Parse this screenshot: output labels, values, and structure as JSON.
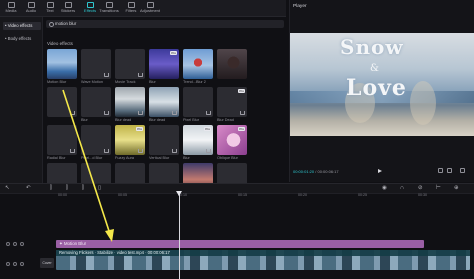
{
  "toolbar": {
    "tabs": [
      {
        "label": "Media",
        "icon": "media-icon"
      },
      {
        "label": "Audio",
        "icon": "audio-icon"
      },
      {
        "label": "Text",
        "icon": "text-icon"
      },
      {
        "label": "Stickers",
        "icon": "stickers-icon"
      },
      {
        "label": "Effects",
        "icon": "effects-icon",
        "active": true
      },
      {
        "label": "Transitions",
        "icon": "transitions-icon"
      },
      {
        "label": "Filters",
        "icon": "filters-icon"
      },
      {
        "label": "Adjustment",
        "icon": "adjustment-icon"
      }
    ],
    "accent_color": "#2fc7cf"
  },
  "left_panel": {
    "categories": [
      {
        "label": "• Video effects",
        "active": true
      },
      {
        "label": "• Body effects",
        "active": false
      }
    ]
  },
  "search": {
    "value": "motion blur"
  },
  "section": {
    "label": "Video effects"
  },
  "effects": [
    {
      "name": "Motion Blur",
      "style": "thumb-photo",
      "pro": false,
      "download": false
    },
    {
      "name": "Wave Motion",
      "style": "thumb-gray",
      "pro": false,
      "download": true
    },
    {
      "name": "Movie Track",
      "style": "thumb-gray",
      "pro": false,
      "download": true
    },
    {
      "name": "Blur",
      "style": "thumb-purple",
      "pro": true,
      "download": false
    },
    {
      "name": "Trend...Blur 2",
      "style": "thumb-photo2",
      "pro": false,
      "download": false
    },
    {
      "name": "",
      "style": "thumb-dark",
      "pro": false,
      "download": false
    },
    {
      "name": "",
      "style": "thumb-gray",
      "pro": false,
      "download": true
    },
    {
      "name": "Blur",
      "style": "thumb-gray",
      "pro": false,
      "download": true
    },
    {
      "name": "Blur dead",
      "style": "thumb-blur",
      "pro": false,
      "download": true
    },
    {
      "name": "Blur dead",
      "style": "thumb-frame",
      "pro": false,
      "download": true
    },
    {
      "name": "Pixel Blur",
      "style": "thumb-gray",
      "pro": false,
      "download": true
    },
    {
      "name": "Blur Dead",
      "style": "thumb-gray",
      "pro": true,
      "download": true
    },
    {
      "name": "Radial Blur",
      "style": "thumb-gray",
      "pro": false,
      "download": true
    },
    {
      "name": "Pixel...d Blur",
      "style": "thumb-gray",
      "pro": false,
      "download": true
    },
    {
      "name": "Fuzzy Aura",
      "style": "thumb-yellow",
      "pro": true,
      "download": true
    },
    {
      "name": "Vertical Blur",
      "style": "thumb-gray",
      "pro": false,
      "download": true
    },
    {
      "name": "Blur",
      "style": "thumb-snow",
      "pro": true,
      "download": true
    },
    {
      "name": "Oblique Blur",
      "style": "thumb-pink",
      "pro": true,
      "download": false
    },
    {
      "name": "Blur",
      "style": "thumb-gray",
      "pro": false,
      "download": true
    },
    {
      "name": "Blur",
      "style": "thumb-gray",
      "pro": false,
      "download": true
    },
    {
      "name": "",
      "style": "thumb-gray",
      "pro": false,
      "download": false
    },
    {
      "name": "",
      "style": "thumb-gray",
      "pro": false,
      "download": false
    },
    {
      "name": "",
      "style": "thumb-sunset",
      "pro": false,
      "download": false
    },
    {
      "name": "",
      "style": "thumb-gray",
      "pro": false,
      "download": false
    }
  ],
  "player": {
    "title": "Player",
    "overlay_line1": "Snow",
    "overlay_amp": "&",
    "overlay_line2": "Love",
    "current_time": "00:00:01:20",
    "total_time": "00:00:06:17"
  },
  "timeline": {
    "ticks": [
      "00:00",
      "00:05",
      "00:10",
      "00:15",
      "00:20",
      "00:25",
      "00:30"
    ],
    "effect_clip_label": "✦ Motion Blur",
    "video_clip_label": "Removing Flickers · Stabilize · video test.mp4 · 00:00:06:17",
    "cover_label": "Cover"
  },
  "annotation": {
    "arrow_color": "#f4e84a"
  }
}
